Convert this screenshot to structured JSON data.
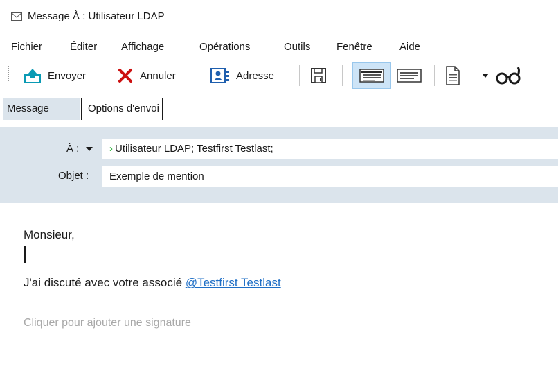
{
  "window": {
    "title": "Message À : Utilisateur LDAP",
    "icon": "envelope-icon"
  },
  "menubar": {
    "items": [
      "Fichier",
      "Éditer",
      "Affichage",
      "Opérations",
      "Outils",
      "Fenêtre",
      "Aide"
    ]
  },
  "toolbar": {
    "send_label": "Envoyer",
    "cancel_label": "Annuler",
    "address_label": "Adresse",
    "icons": [
      "send-icon",
      "cancel-x-icon",
      "address-book-icon",
      "save-disk-icon",
      "format-html-icon",
      "format-text-icon",
      "attach-document-icon",
      "dropdown-arrow-icon",
      "glasses-icon"
    ],
    "colors": {
      "send": "#0a9ab4",
      "cancel": "#cc1010",
      "address": "#1f5fae",
      "pressed": "#cde4f7"
    }
  },
  "tabs": [
    {
      "label": "Message",
      "active": true
    },
    {
      "label": "Options d'envoi",
      "active": false
    }
  ],
  "header": {
    "to_label": "À :",
    "to_arrow": "›",
    "to_value": "Utilisateur LDAP;  Testfirst Testlast;",
    "subject_label": "Objet :",
    "subject_value": "Exemple de mention",
    "panel_color": "#dbe4ec"
  },
  "body": {
    "greeting": "Monsieur,",
    "line_prefix": "J'ai discuté avec votre associé ",
    "mention": "@Testfirst  Testlast",
    "signature_placeholder": "Cliquer pour ajouter une signature",
    "mention_color": "#1f6fc6"
  }
}
